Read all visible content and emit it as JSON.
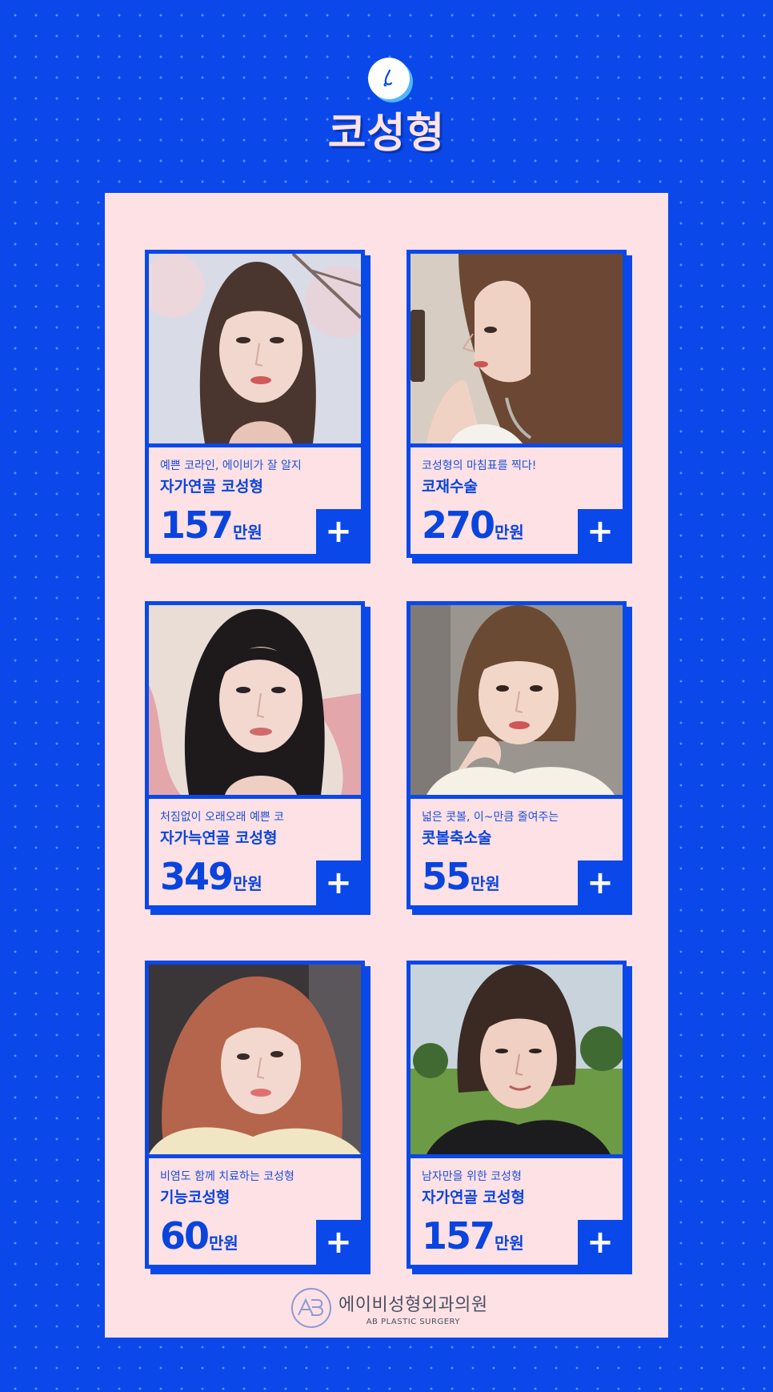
{
  "header": {
    "icon": "nose-icon",
    "title": "코성형"
  },
  "colors": {
    "brand_blue": "#0a48ea",
    "panel_pink": "#fde1e4",
    "title_pink": "#fde3e6",
    "text_blue": "#0a44de"
  },
  "cards": [
    {
      "subtitle": "예쁜 코라인, 에이비가 잘 알지",
      "name": "자가연골 코성형",
      "price": "157",
      "unit": "만원",
      "button": "+",
      "photo": "woman-long-brown-hair-cherry-blossoms"
    },
    {
      "subtitle": "코성형의 마침표를 찍다!",
      "name": "코재수술",
      "price": "270",
      "unit": "만원",
      "button": "+",
      "photo": "woman-side-profile-mirror-selfie"
    },
    {
      "subtitle": "처짐없이 오래오래 예쁜 코",
      "name": "자가늑연골 코성형",
      "price": "349",
      "unit": "만원",
      "button": "+",
      "photo": "woman-black-hair-pink-chair"
    },
    {
      "subtitle": "넓은 콧볼, 이~만큼 줄여주는",
      "name": "콧볼축소술",
      "price": "55",
      "unit": "만원",
      "button": "+",
      "photo": "woman-short-bob-hand-on-chin"
    },
    {
      "subtitle": "비염도 함께 치료하는 코성형",
      "name": "기능코성형",
      "price": "60",
      "unit": "만원",
      "button": "+",
      "photo": "woman-auburn-hair-car-selfie"
    },
    {
      "subtitle": "남자만을 위한 코성형",
      "name": "자가연골 코성형",
      "price": "157",
      "unit": "만원",
      "button": "+",
      "photo": "man-park-selfie"
    }
  ],
  "footer": {
    "logo_icon": "ab-logo-icon",
    "clinic_name": "에이비성형외과의원",
    "clinic_name_en": "AB PLASTIC SURGERY"
  }
}
